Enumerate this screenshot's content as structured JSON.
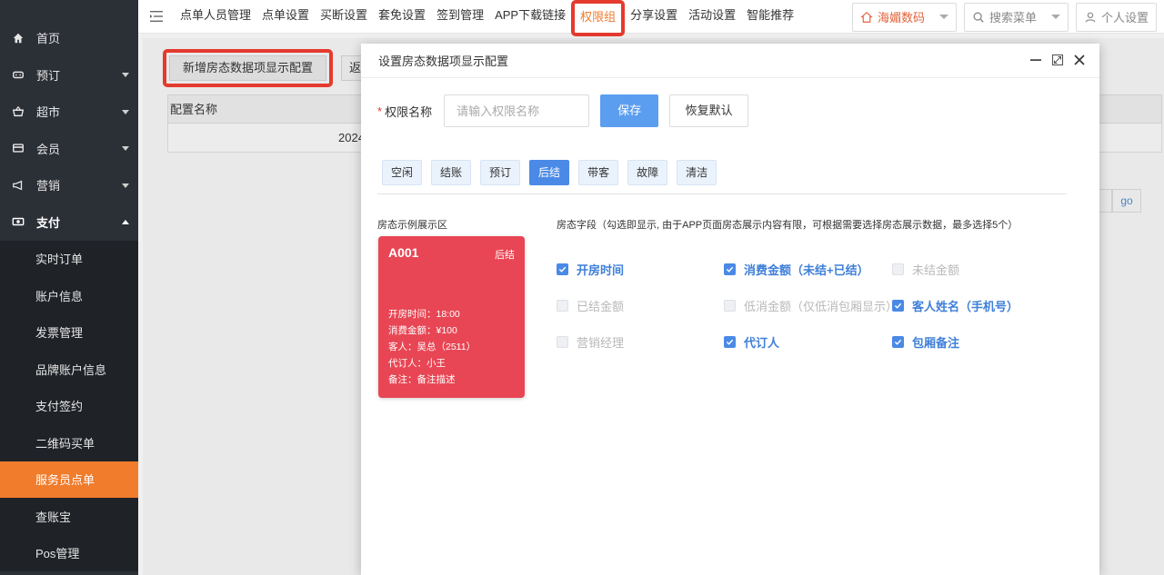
{
  "sidebar": {
    "items": [
      {
        "label": "首页",
        "icon": "home-icon"
      },
      {
        "label": "预订",
        "icon": "booking-icon"
      },
      {
        "label": "超市",
        "icon": "basket-icon"
      },
      {
        "label": "会员",
        "icon": "card-icon"
      },
      {
        "label": "营销",
        "icon": "megaphone-icon"
      },
      {
        "label": "支付",
        "icon": "payment-icon"
      }
    ],
    "sub_items": [
      "实时订单",
      "账户信息",
      "发票管理",
      "品牌账户信息",
      "支付签约",
      "二维码买单",
      "服务员点单",
      "查账宝",
      "Pos管理"
    ],
    "active_sub": "服务员点单"
  },
  "topnav": {
    "tabs": [
      "点单人员管理",
      "点单设置",
      "买断设置",
      "套免设置",
      "签到管理",
      "APP下载链接",
      "权限组",
      "分享设置",
      "活动设置",
      "智能推荐"
    ],
    "active_tab": "权限组",
    "shop": "海媚数码",
    "search_placeholder": "搜索菜单",
    "user_settings": "个人设置"
  },
  "background": {
    "add_button": "新增房态数据项显示配置",
    "back_button": "返回",
    "column_header": "配置名称",
    "row_value": "2024",
    "go_button": "go"
  },
  "modal": {
    "title": "设置房态数据项显示配置",
    "form": {
      "label": "权限名称",
      "placeholder": "请输入权限名称",
      "save": "保存",
      "reset": "恢复默认"
    },
    "status_tabs": [
      "空闲",
      "结账",
      "预订",
      "后结",
      "带客",
      "故障",
      "清洁"
    ],
    "active_status": "后结",
    "demo_title": "房态示例展示区",
    "card": {
      "room": "A001",
      "status": "后结",
      "lines": [
        "开房时间：18:00",
        "消费金额：¥100",
        "客人：吴总（2511）",
        "代订人：小王",
        "备注：备注描述"
      ],
      "color": "#e84654"
    },
    "fields_title": "房态字段（勾选即显示, 由于APP页面房态展示内容有限，可根据需要选择房态展示数据，最多选择5个）",
    "fields": [
      {
        "label": "开房时间",
        "checked": true
      },
      {
        "label": "消费金额（未结+已结）",
        "checked": true
      },
      {
        "label": "未结金额",
        "checked": false
      },
      {
        "label": "已结金额",
        "checked": false
      },
      {
        "label": "低消金额（仅低消包厢显示）",
        "checked": false
      },
      {
        "label": "客人姓名（手机号）",
        "checked": true
      },
      {
        "label": "营销经理",
        "checked": false
      },
      {
        "label": "代订人",
        "checked": true
      },
      {
        "label": "包厢备注",
        "checked": true
      }
    ]
  },
  "colors": {
    "accent": "#f07c2c",
    "primary": "#4a8ae6",
    "highlight_box": "#e53a2e"
  }
}
